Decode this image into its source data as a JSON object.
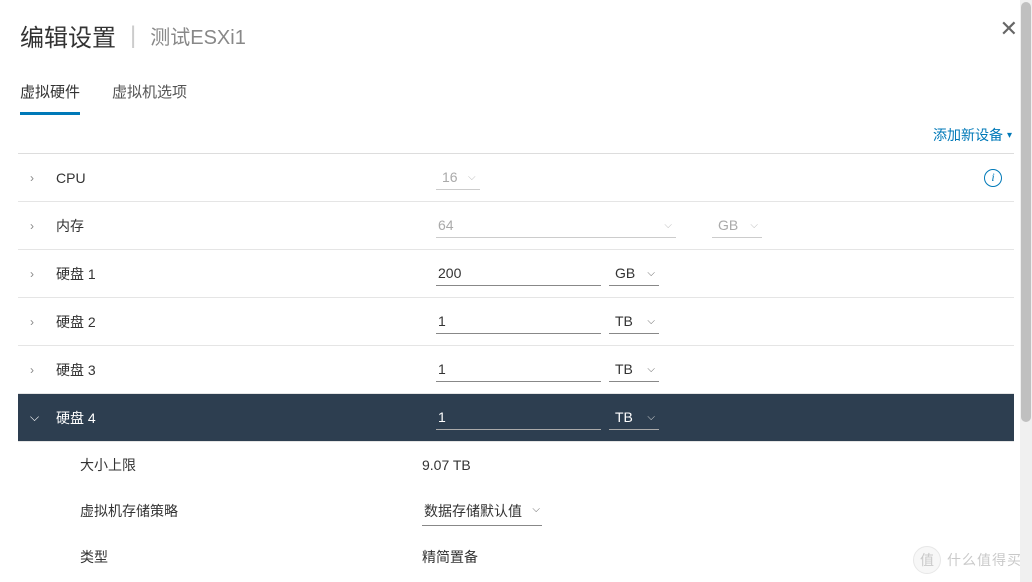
{
  "header": {
    "title": "编辑设置",
    "subtitle": "测试ESXi1"
  },
  "tabs": {
    "hardware": "虚拟硬件",
    "options": "虚拟机选项"
  },
  "actions": {
    "add_device": "添加新设备"
  },
  "rows": {
    "cpu": {
      "label": "CPU",
      "value": "16"
    },
    "memory": {
      "label": "内存",
      "value": "64",
      "unit": "GB"
    },
    "disk1": {
      "label": "硬盘 1",
      "value": "200",
      "unit": "GB"
    },
    "disk2": {
      "label": "硬盘 2",
      "value": "1",
      "unit": "TB"
    },
    "disk3": {
      "label": "硬盘 3",
      "value": "1",
      "unit": "TB"
    },
    "disk4": {
      "label": "硬盘 4",
      "value": "1",
      "unit": "TB"
    }
  },
  "disk4_detail": {
    "max_size_label": "大小上限",
    "max_size_value": "9.07 TB",
    "policy_label": "虚拟机存储策略",
    "policy_value": "数据存储默认值",
    "type_label": "类型",
    "type_value": "精简置备"
  },
  "watermark": {
    "icon": "值",
    "text": "什么值得买"
  }
}
